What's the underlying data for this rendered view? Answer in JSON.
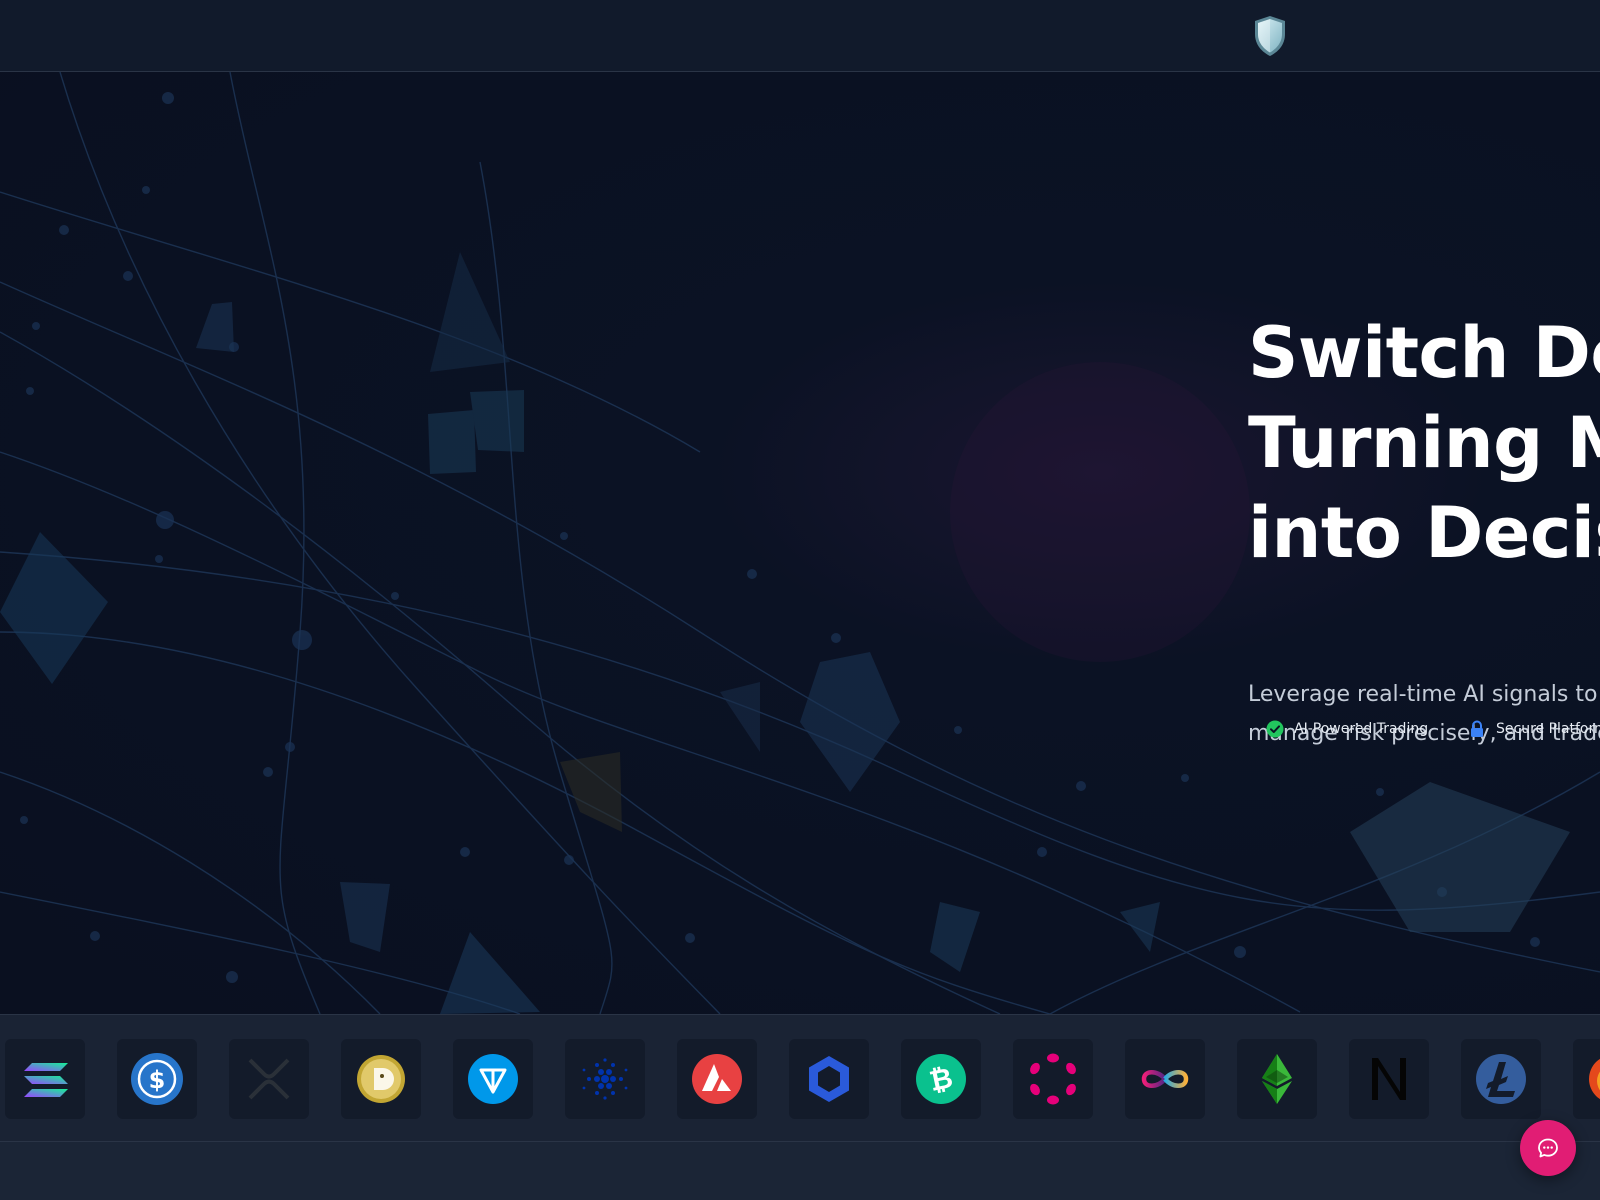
{
  "nav": {
    "logo_icon": "shield-icon"
  },
  "hero": {
    "headline_lines": [
      "Switch Dex",
      "Turning Ma",
      "into Decisi"
    ],
    "subtext_lines": [
      "Leverage real-time AI signals to s",
      "manage risk precisely, and trade"
    ],
    "badges": [
      {
        "label": "AI-Powered Trading",
        "icon": "check-circle-icon",
        "color": "#22c55e"
      },
      {
        "label": "Secure Platform",
        "icon": "lock-icon",
        "color": "#3b82f6"
      }
    ]
  },
  "crypto_logos": [
    {
      "name": "solana-logo",
      "color": "#14f195"
    },
    {
      "name": "usdc-logo",
      "color": "#2775ca"
    },
    {
      "name": "xrp-logo",
      "color": "#23292f"
    },
    {
      "name": "dogecoin-logo",
      "color": "#c2a633"
    },
    {
      "name": "toncoin-logo",
      "color": "#0098ea"
    },
    {
      "name": "cardano-logo",
      "color": "#0033ad"
    },
    {
      "name": "avalanche-logo",
      "color": "#e84142"
    },
    {
      "name": "chainlink-logo",
      "color": "#2a5ada"
    },
    {
      "name": "bitcoin-cash-logo",
      "color": "#0ac18e"
    },
    {
      "name": "polkadot-logo",
      "color": "#e6007a"
    },
    {
      "name": "internet-computer-logo",
      "color": "#29abe2"
    },
    {
      "name": "ethereum-classic-logo",
      "color": "#3ab83a"
    },
    {
      "name": "near-logo",
      "color": "#000000"
    },
    {
      "name": "litecoin-logo",
      "color": "#345d9d"
    },
    {
      "name": "shiba-inu-logo",
      "color": "#e4491c"
    }
  ],
  "chat": {
    "icon": "chat-bubble-icon",
    "color": "#e11d74"
  }
}
